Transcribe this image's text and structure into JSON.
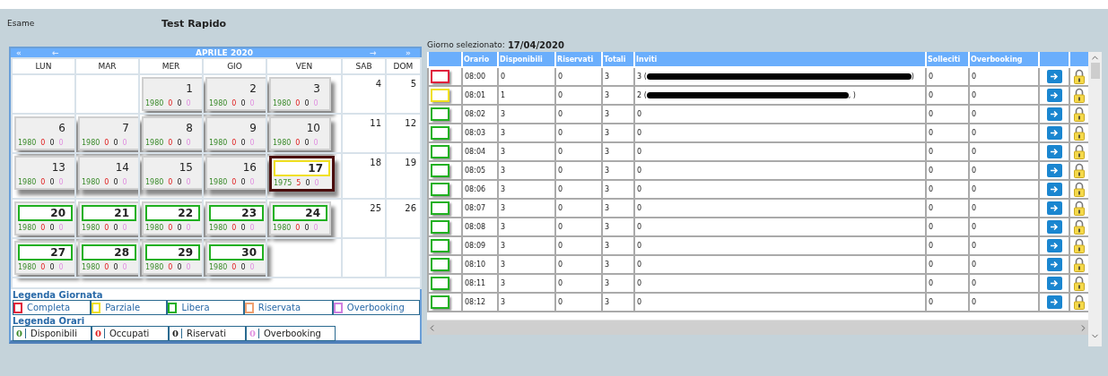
{
  "exam": {
    "label": "Esame",
    "value": "Test Rapido"
  },
  "calendar": {
    "nav": {
      "first": "«",
      "prev": "←",
      "next": "→",
      "last": "»"
    },
    "title": "APRILE 2020",
    "weekdays": [
      "LUN",
      "MAR",
      "MER",
      "GIO",
      "VEN",
      "SAB",
      "DOM"
    ],
    "weeks": [
      [
        {
          "kind": "empty"
        },
        {
          "kind": "empty"
        },
        {
          "kind": "booked",
          "day": "1",
          "selected": false,
          "counts": [
            "1980",
            "0",
            "0",
            "0"
          ]
        },
        {
          "kind": "booked",
          "day": "2",
          "selected": false,
          "counts": [
            "1980",
            "0",
            "0",
            "0"
          ]
        },
        {
          "kind": "booked",
          "day": "3",
          "selected": false,
          "counts": [
            "1980",
            "0",
            "0",
            "0"
          ]
        },
        {
          "kind": "plain",
          "day": "4"
        },
        {
          "kind": "plain",
          "day": "5"
        }
      ],
      [
        {
          "kind": "booked",
          "day": "6",
          "selected": false,
          "counts": [
            "1980",
            "0",
            "0",
            "0"
          ]
        },
        {
          "kind": "booked",
          "day": "7",
          "selected": false,
          "counts": [
            "1980",
            "0",
            "0",
            "0"
          ]
        },
        {
          "kind": "booked",
          "day": "8",
          "selected": false,
          "counts": [
            "1980",
            "0",
            "0",
            "0"
          ]
        },
        {
          "kind": "booked",
          "day": "9",
          "selected": false,
          "counts": [
            "1980",
            "0",
            "0",
            "0"
          ]
        },
        {
          "kind": "booked",
          "day": "10",
          "selected": false,
          "counts": [
            "1980",
            "0",
            "0",
            "0"
          ]
        },
        {
          "kind": "plain",
          "day": "11"
        },
        {
          "kind": "plain",
          "day": "12"
        }
      ],
      [
        {
          "kind": "booked",
          "day": "13",
          "selected": false,
          "counts": [
            "1980",
            "0",
            "0",
            "0"
          ]
        },
        {
          "kind": "booked",
          "day": "14",
          "selected": false,
          "counts": [
            "1980",
            "0",
            "0",
            "0"
          ]
        },
        {
          "kind": "booked",
          "day": "15",
          "selected": false,
          "counts": [
            "1980",
            "0",
            "0",
            "0"
          ]
        },
        {
          "kind": "booked",
          "day": "16",
          "selected": false,
          "counts": [
            "1980",
            "0",
            "0",
            "0"
          ]
        },
        {
          "kind": "partial",
          "day": "17",
          "selected": true,
          "counts": [
            "1975",
            "5",
            "0",
            "0"
          ]
        },
        {
          "kind": "plain",
          "day": "18"
        },
        {
          "kind": "plain",
          "day": "19"
        }
      ],
      [
        {
          "kind": "free",
          "day": "20",
          "selected": false,
          "counts": [
            "1980",
            "0",
            "0",
            "0"
          ]
        },
        {
          "kind": "free",
          "day": "21",
          "selected": false,
          "counts": [
            "1980",
            "0",
            "0",
            "0"
          ]
        },
        {
          "kind": "free",
          "day": "22",
          "selected": false,
          "counts": [
            "1980",
            "0",
            "0",
            "0"
          ]
        },
        {
          "kind": "free",
          "day": "23",
          "selected": false,
          "counts": [
            "1980",
            "0",
            "0",
            "0"
          ]
        },
        {
          "kind": "free",
          "day": "24",
          "selected": false,
          "counts": [
            "1980",
            "0",
            "0",
            "0"
          ]
        },
        {
          "kind": "plain",
          "day": "25"
        },
        {
          "kind": "plain",
          "day": "26"
        }
      ],
      [
        {
          "kind": "free",
          "day": "27",
          "selected": false,
          "counts": [
            "1980",
            "0",
            "0",
            "0"
          ]
        },
        {
          "kind": "free",
          "day": "28",
          "selected": false,
          "counts": [
            "1980",
            "0",
            "0",
            "0"
          ]
        },
        {
          "kind": "free",
          "day": "29",
          "selected": false,
          "counts": [
            "1980",
            "0",
            "0",
            "0"
          ]
        },
        {
          "kind": "free",
          "day": "30",
          "selected": false,
          "counts": [
            "1980",
            "0",
            "0",
            "0"
          ]
        },
        {
          "kind": "empty"
        },
        {
          "kind": "empty"
        },
        {
          "kind": "empty"
        }
      ]
    ],
    "legend_day": {
      "title": "Legenda Giornata",
      "items": [
        {
          "label": "Completa",
          "color": "#e0203c"
        },
        {
          "label": "Parziale",
          "color": "#f0e020"
        },
        {
          "label": "Libera",
          "color": "#20b020"
        },
        {
          "label": "Riservata",
          "color": "#f0a070"
        },
        {
          "label": "Overbooking",
          "color": "#d080e0"
        }
      ]
    },
    "legend_hours": {
      "title": "Legenda Orari",
      "items": [
        {
          "value": "0",
          "label": "Disponibili",
          "color": "#3a8a2a"
        },
        {
          "value": "0",
          "label": "Occupati",
          "color": "#e02020"
        },
        {
          "value": "0",
          "label": "Riservati",
          "color": "#202020"
        },
        {
          "value": "0",
          "label": "Overbooking",
          "color": "#e090e0"
        }
      ]
    }
  },
  "selected_day": {
    "label": "Giorno selezionato:",
    "value": "17/04/2020"
  },
  "table": {
    "columns": [
      "Orario",
      "Disponibili",
      "Riservati",
      "Totali",
      "Inviti",
      "Solleciti",
      "Overbooking"
    ],
    "rows": [
      {
        "color": "#e0203c",
        "time": "08:00",
        "available": "0",
        "reserved": "0",
        "total": "3",
        "invites": "3 (",
        "redacted": true,
        "invites_end": ")",
        "reminders": "0",
        "overbooking": "0"
      },
      {
        "color": "#f0e020",
        "time": "08:01",
        "available": "1",
        "reserved": "0",
        "total": "3",
        "invites": "2 (",
        "redacted": true,
        "invites_end": ", )",
        "reminders": "0",
        "overbooking": "0"
      },
      {
        "color": "#20b020",
        "time": "08:02",
        "available": "3",
        "reserved": "0",
        "total": "3",
        "invites": "0",
        "redacted": false,
        "reminders": "0",
        "overbooking": "0"
      },
      {
        "color": "#20b020",
        "time": "08:03",
        "available": "3",
        "reserved": "0",
        "total": "3",
        "invites": "0",
        "redacted": false,
        "reminders": "0",
        "overbooking": "0"
      },
      {
        "color": "#20b020",
        "time": "08:04",
        "available": "3",
        "reserved": "0",
        "total": "3",
        "invites": "0",
        "redacted": false,
        "reminders": "0",
        "overbooking": "0"
      },
      {
        "color": "#20b020",
        "time": "08:05",
        "available": "3",
        "reserved": "0",
        "total": "3",
        "invites": "0",
        "redacted": false,
        "reminders": "0",
        "overbooking": "0"
      },
      {
        "color": "#20b020",
        "time": "08:06",
        "available": "3",
        "reserved": "0",
        "total": "3",
        "invites": "0",
        "redacted": false,
        "reminders": "0",
        "overbooking": "0"
      },
      {
        "color": "#20b020",
        "time": "08:07",
        "available": "3",
        "reserved": "0",
        "total": "3",
        "invites": "0",
        "redacted": false,
        "reminders": "0",
        "overbooking": "0"
      },
      {
        "color": "#20b020",
        "time": "08:08",
        "available": "3",
        "reserved": "0",
        "total": "3",
        "invites": "0",
        "redacted": false,
        "reminders": "0",
        "overbooking": "0"
      },
      {
        "color": "#20b020",
        "time": "08:09",
        "available": "3",
        "reserved": "0",
        "total": "3",
        "invites": "0",
        "redacted": false,
        "reminders": "0",
        "overbooking": "0"
      },
      {
        "color": "#20b020",
        "time": "08:10",
        "available": "3",
        "reserved": "0",
        "total": "3",
        "invites": "0",
        "redacted": false,
        "reminders": "0",
        "overbooking": "0"
      },
      {
        "color": "#20b020",
        "time": "08:11",
        "available": "3",
        "reserved": "0",
        "total": "3",
        "invites": "0",
        "redacted": false,
        "reminders": "0",
        "overbooking": "0"
      },
      {
        "color": "#20b020",
        "time": "08:12",
        "available": "3",
        "reserved": "0",
        "total": "3",
        "invites": "0",
        "redacted": false,
        "reminders": "0",
        "overbooking": "0"
      }
    ]
  }
}
